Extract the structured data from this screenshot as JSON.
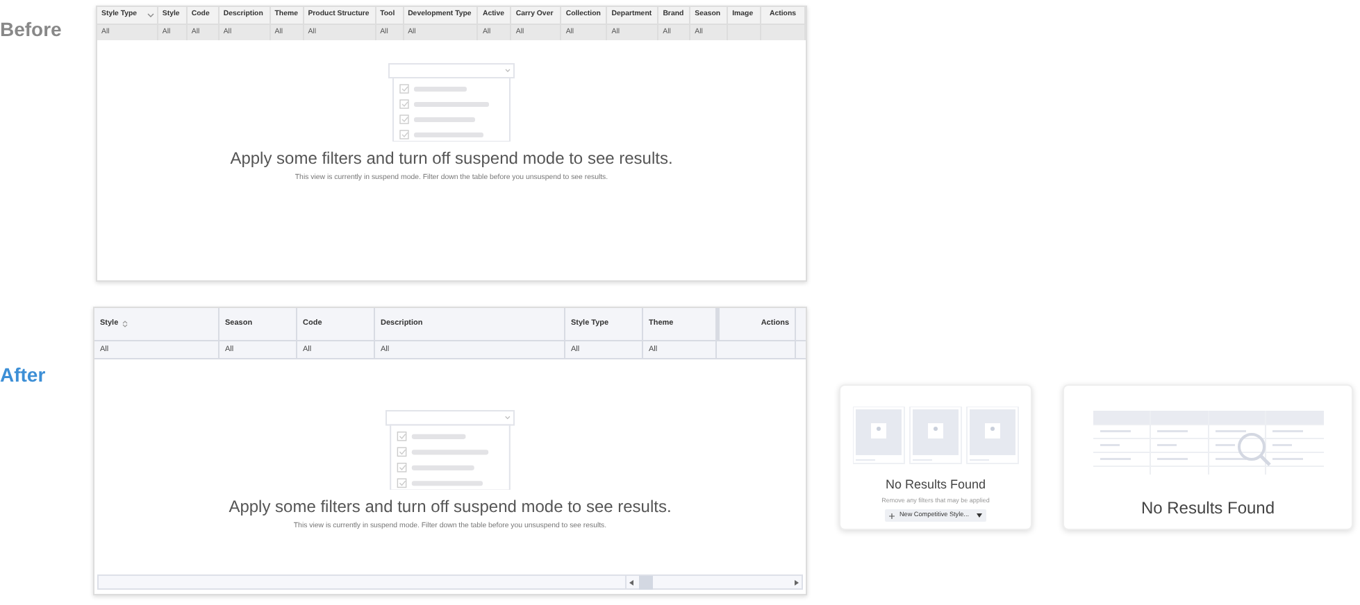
{
  "before": {
    "label": "Before",
    "columns": [
      {
        "label": "Style Type",
        "sorted": true,
        "filter": "All"
      },
      {
        "label": "Style",
        "sorted": false,
        "filter": "All"
      },
      {
        "label": "Code",
        "sorted": false,
        "filter": "All"
      },
      {
        "label": "Description",
        "sorted": false,
        "filter": "All"
      },
      {
        "label": "Theme",
        "sorted": false,
        "filter": "All"
      },
      {
        "label": "Product Structure",
        "sorted": false,
        "filter": "All"
      },
      {
        "label": "Tool",
        "sorted": false,
        "filter": "All"
      },
      {
        "label": "Development Type",
        "sorted": false,
        "filter": "All"
      },
      {
        "label": "Active",
        "sorted": false,
        "filter": "All"
      },
      {
        "label": "Carry Over",
        "sorted": false,
        "filter": "All"
      },
      {
        "label": "Collection",
        "sorted": false,
        "filter": "All"
      },
      {
        "label": "Department",
        "sorted": false,
        "filter": "All"
      },
      {
        "label": "Brand",
        "sorted": false,
        "filter": "All"
      },
      {
        "label": "Season",
        "sorted": false,
        "filter": "All"
      },
      {
        "label": "Image",
        "sorted": false
      },
      {
        "label": "Actions",
        "sorted": false
      }
    ],
    "empty_state": {
      "title": "Apply some filters and turn off suspend mode to see results.",
      "message": "This view is currently in suspend mode. Filter down the table before you unsuspend to see results."
    }
  },
  "after": {
    "label": "After",
    "columns": [
      {
        "label": "Style",
        "sorted": true,
        "filter": "All"
      },
      {
        "label": "Season",
        "sorted": false,
        "filter": "All"
      },
      {
        "label": "Code",
        "sorted": false,
        "filter": "All"
      },
      {
        "label": "Description",
        "sorted": false,
        "filter": "All"
      },
      {
        "label": "Style Type",
        "sorted": false,
        "filter": "All"
      },
      {
        "label": "Theme",
        "sorted": false,
        "filter": "All"
      },
      {
        "label": "Actions",
        "sorted": false
      }
    ],
    "empty_state": {
      "title": "Apply some filters and turn off suspend mode to see results.",
      "message": "This view is currently in suspend mode. Filter down the table before you unsuspend to see results."
    },
    "cards": [
      {
        "kind": "grid",
        "title": "No Results Found",
        "message": "Remove any filters that may be applied",
        "button": "New Competitive Style..."
      },
      {
        "kind": "table",
        "title": "No Results Found"
      }
    ]
  }
}
